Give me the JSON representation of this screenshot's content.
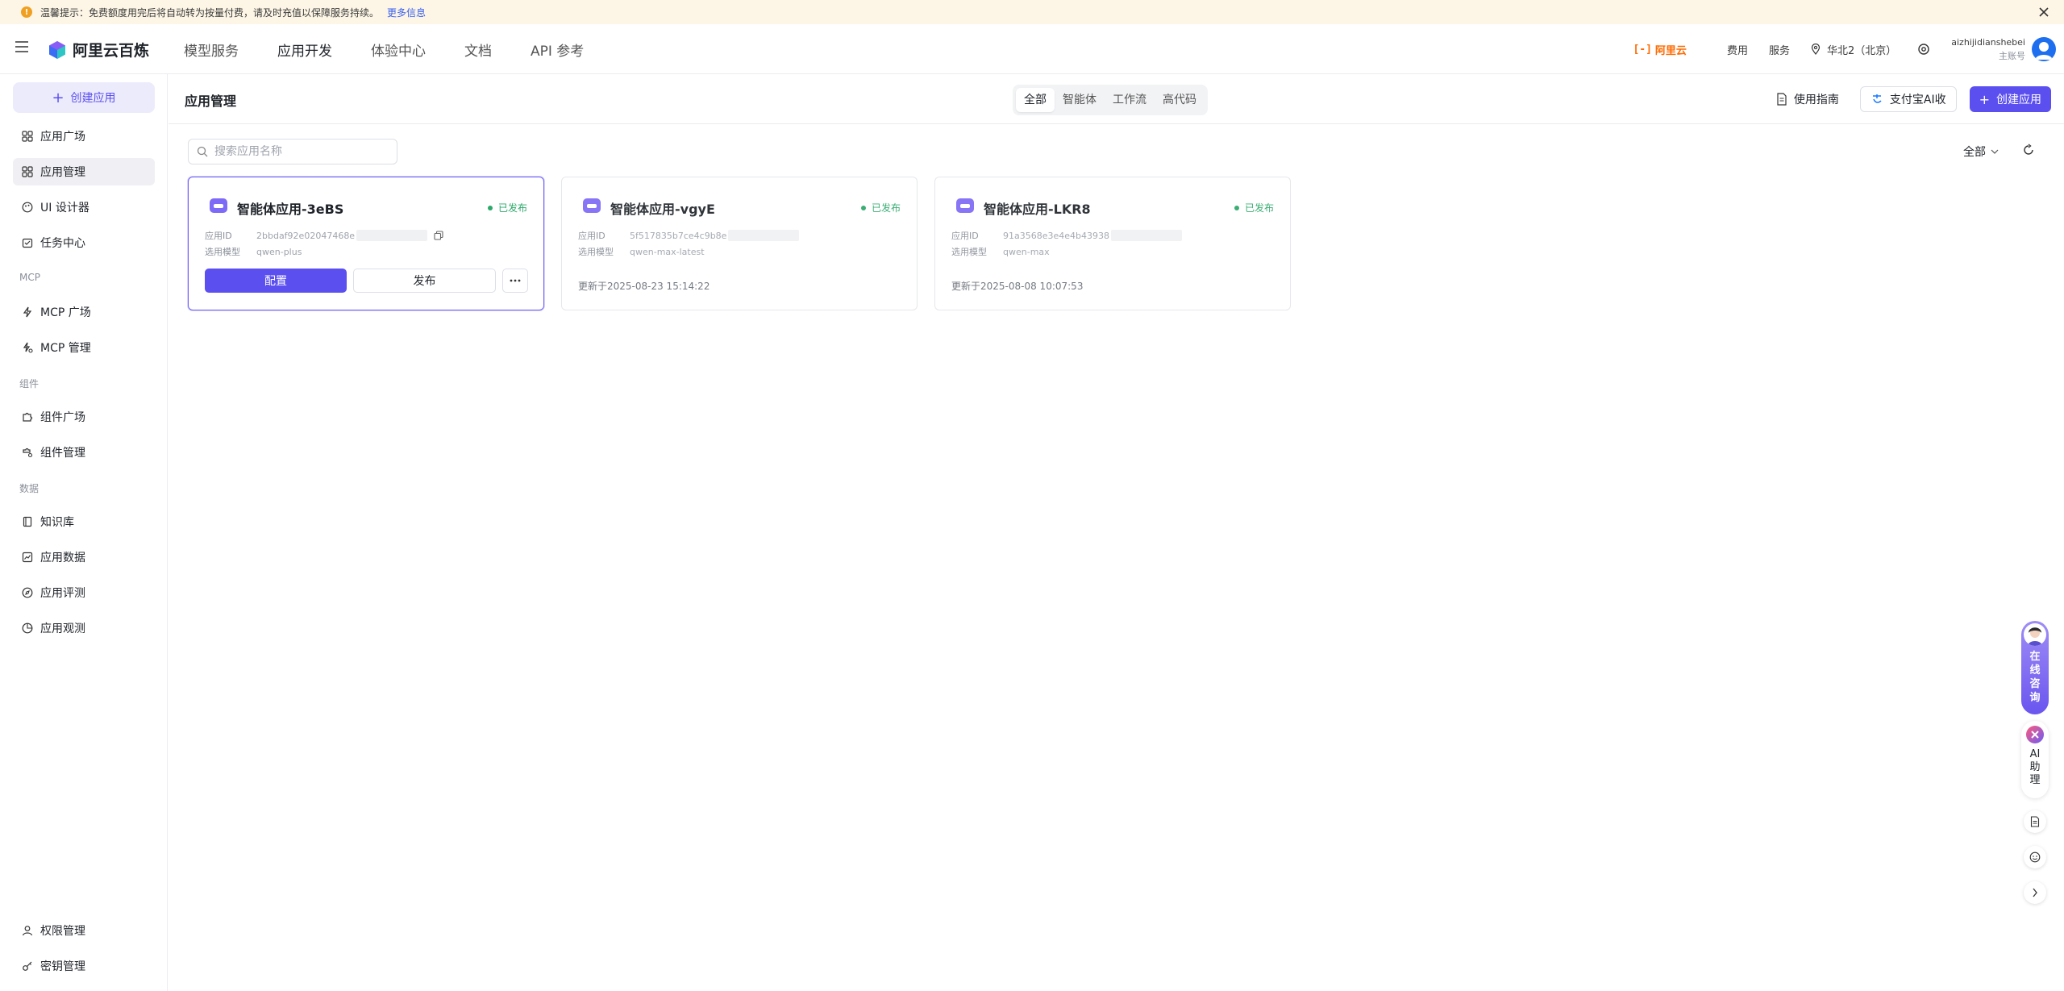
{
  "notice": {
    "text": "温馨提示：免费额度用完后将自动转为按量付费，请及时充值以保障服务持续。",
    "more_link": "更多信息"
  },
  "header": {
    "logo_text": "阿里云百炼",
    "nav": [
      "模型服务",
      "应用开发",
      "体验中心",
      "文档",
      "API 参考"
    ],
    "active_nav": "应用开发",
    "aliyun_text": "阿里云",
    "links": {
      "cost": "费用",
      "service": "服务"
    },
    "region": "华北2（北京）",
    "account_name": "aizhijidianshebei",
    "account_type": "主账号"
  },
  "sidebar": {
    "create_label": "创建应用",
    "items": [
      {
        "label": "应用广场",
        "icon": "grid-icon"
      },
      {
        "label": "应用管理",
        "icon": "grid-icon",
        "active": true
      },
      {
        "label": "UI 设计器",
        "icon": "palette-icon"
      },
      {
        "label": "任务中心",
        "icon": "task-icon"
      }
    ],
    "groups": {
      "mcp": "MCP",
      "component": "组件",
      "data": "数据"
    },
    "mcp_items": [
      {
        "label": "MCP 广场"
      },
      {
        "label": "MCP 管理"
      }
    ],
    "component_items": [
      {
        "label": "组件广场"
      },
      {
        "label": "组件管理"
      }
    ],
    "data_items": [
      {
        "label": "知识库"
      },
      {
        "label": "应用数据"
      },
      {
        "label": "应用评测"
      },
      {
        "label": "应用观测"
      }
    ],
    "bottom_items": [
      {
        "label": "权限管理"
      },
      {
        "label": "密钥管理"
      }
    ]
  },
  "main": {
    "title": "应用管理",
    "tabs": [
      "全部",
      "智能体",
      "工作流",
      "高代码"
    ],
    "active_tab": "全部",
    "guide_label": "使用指南",
    "alipay_label": "支付宝AI收",
    "create_label": "创建应用",
    "search_placeholder": "搜索应用名称",
    "filter_label": "全部"
  },
  "cards": [
    {
      "title": "智能体应用-3eBS",
      "status": "已发布",
      "id_label": "应用ID",
      "id_value": "2bbdaf92e02047468e",
      "model_label": "选用模型",
      "model_value": "qwen-plus",
      "config_label": "配置",
      "publish_label": "发布"
    },
    {
      "title": "智能体应用-vgyE",
      "status": "已发布",
      "id_label": "应用ID",
      "id_value": "5f517835b7ce4c9b8e",
      "model_label": "选用模型",
      "model_value": "qwen-max-latest",
      "updated": "更新于2025-08-23 15:14:22"
    },
    {
      "title": "智能体应用-LKR8",
      "status": "已发布",
      "id_label": "应用ID",
      "id_value": "91a3568e3e4e4b43938",
      "model_label": "选用模型",
      "model_value": "qwen-max",
      "updated": "更新于2025-08-08 10:07:53"
    }
  ],
  "floating": {
    "consult_label": "在线咨询",
    "ai_help_label": "AI助理"
  },
  "colors": {
    "brand": "#5b4ff0",
    "status_published": "#2ca86a",
    "aliyun_orange": "#ff6a00",
    "notice_bg": "#fdf6e6"
  }
}
